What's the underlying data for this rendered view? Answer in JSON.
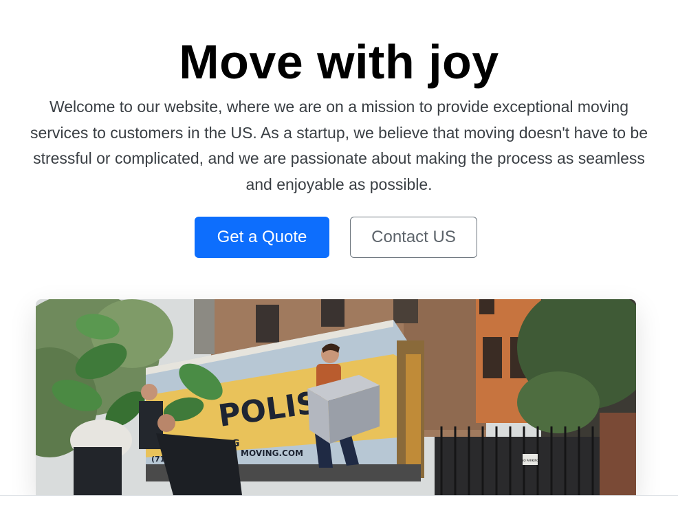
{
  "hero": {
    "title": "Move with joy",
    "lead": "Welcome to our website, where we are on a mission to provide exceptional moving services to customers in the US. As a startup, we believe that moving doesn't have to be stressful or complicated, and we are passionate about making the process as seamless and enjoyable as possible.",
    "primary_button_label": "Get a Quote",
    "secondary_button_label": "Contact US"
  },
  "image": {
    "truck_text_brand": "POLIS",
    "truck_text_sub": "G",
    "truck_text_phone": "(718) 7  520",
    "truck_text_site": "MOVING.COM",
    "gate_sign": "NO PARKING"
  },
  "colors": {
    "primary": "#0d6efd",
    "secondary": "#6c757d"
  }
}
